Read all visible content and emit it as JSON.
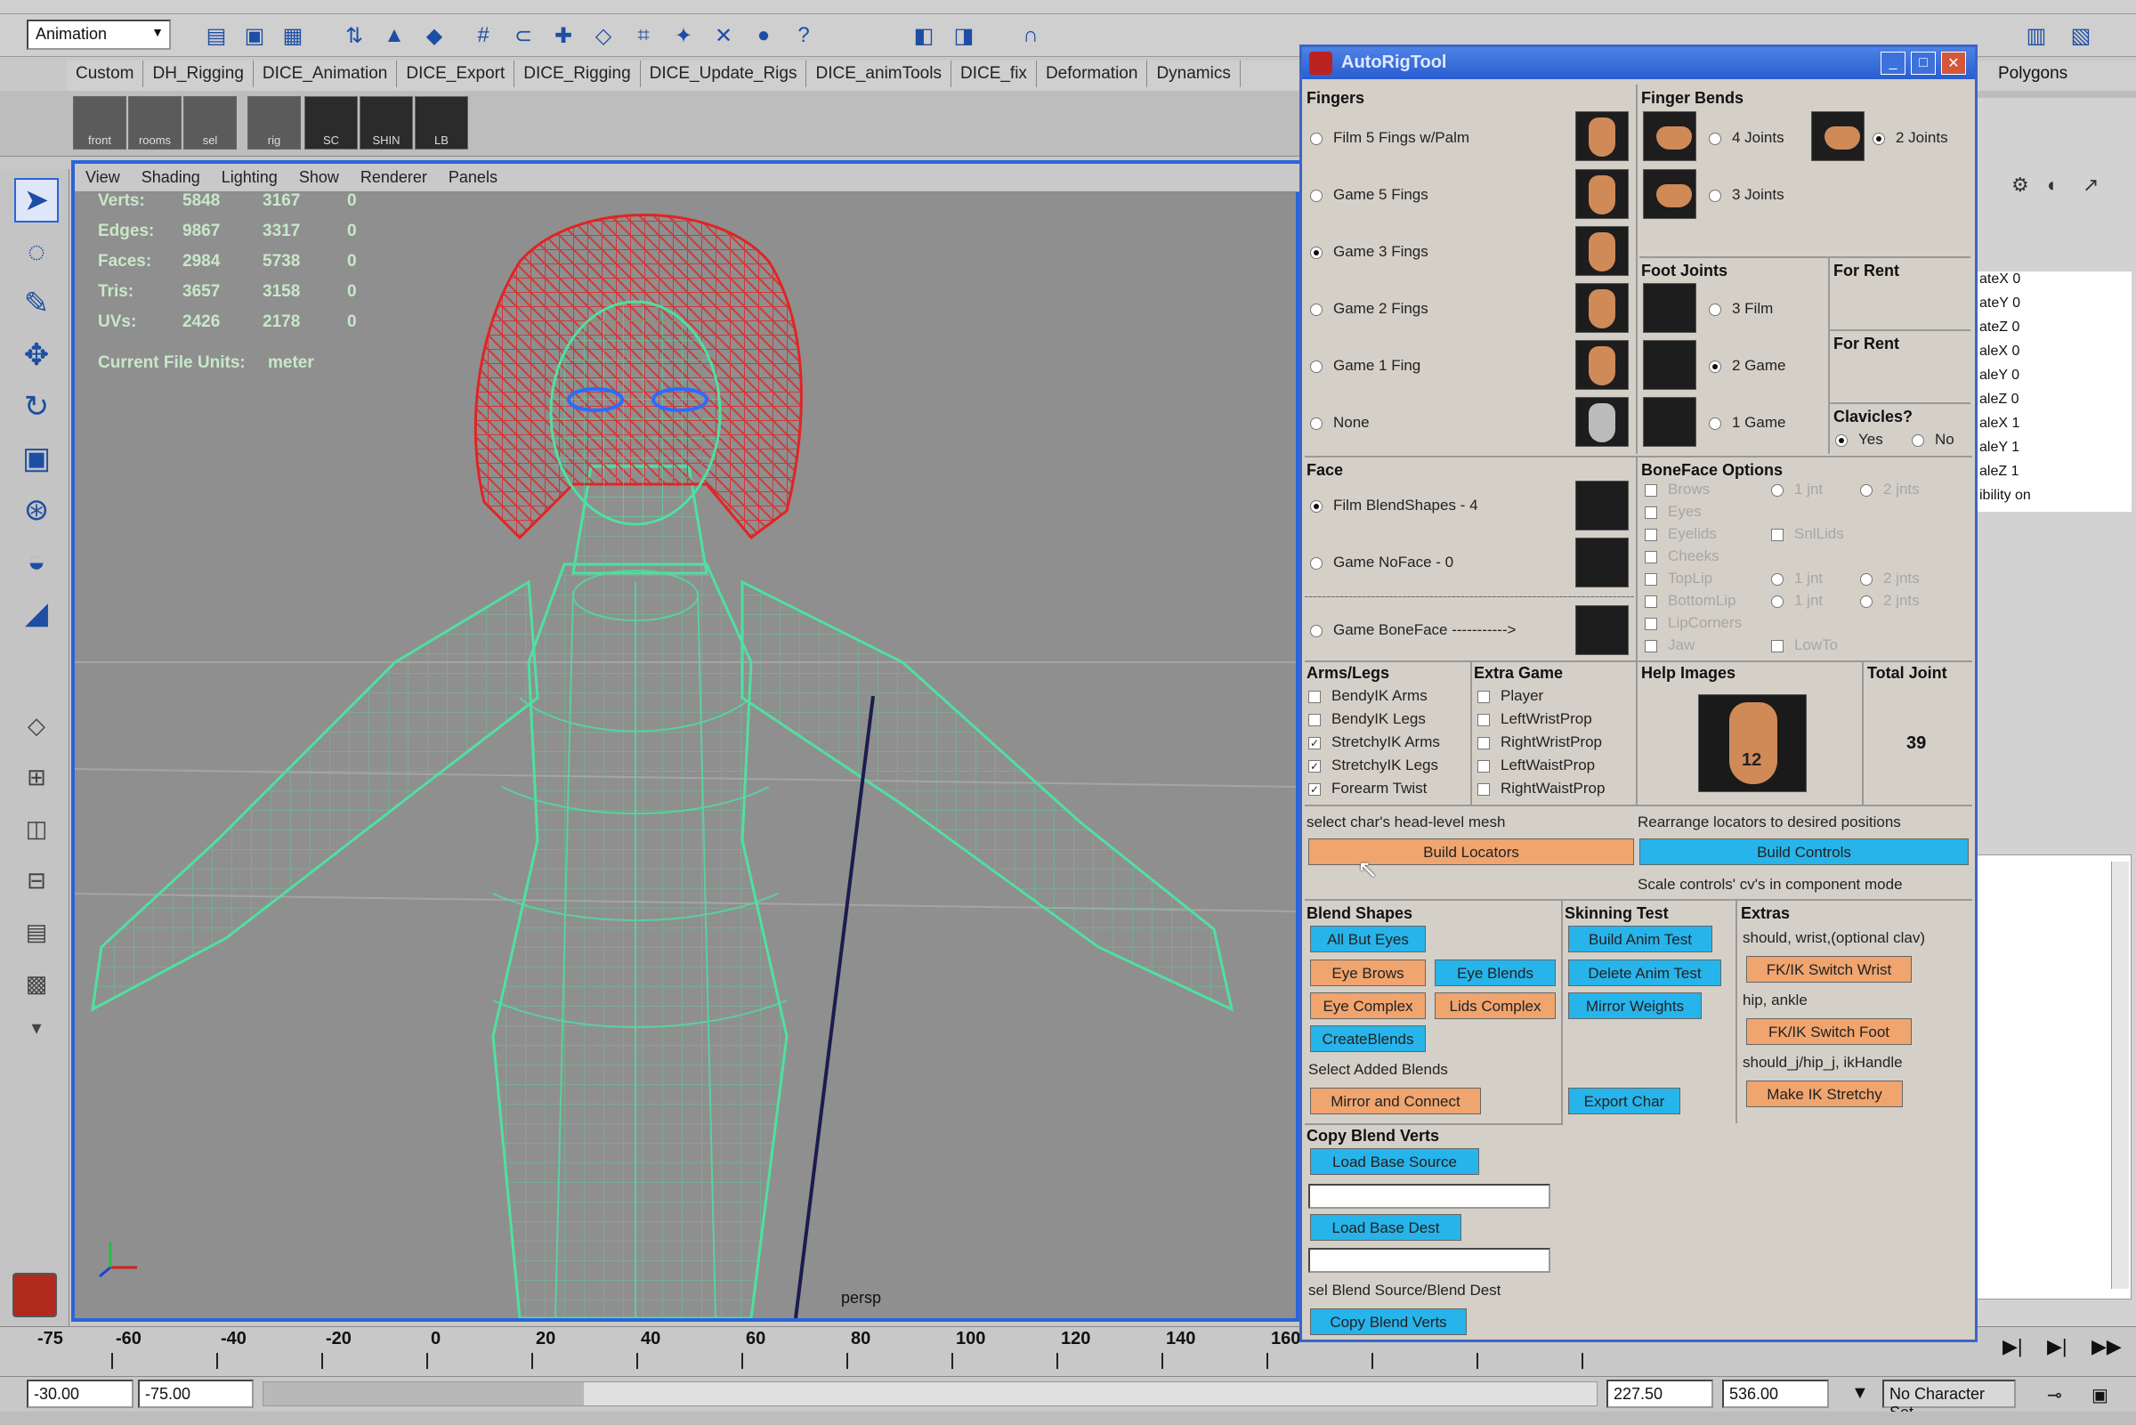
{
  "top": {
    "mode_select": "Animation",
    "shelf_tabs": [
      "Custom",
      "DH_Rigging",
      "DICE_Animation",
      "DICE_Export",
      "DICE_Rigging",
      "DICE_Update_Rigs",
      "DICE_animTools",
      "DICE_fix",
      "Deformation",
      "Dynamics",
      "Polygons"
    ],
    "shelf_icons": [
      "front",
      "rooms",
      "sel",
      "rig",
      "SC",
      "SHIN",
      "LB"
    ]
  },
  "viewport": {
    "menu": [
      "View",
      "Shading",
      "Lighting",
      "Show",
      "Renderer",
      "Panels"
    ],
    "hud": [
      {
        "label": "Verts:",
        "a": "5848",
        "b": "3167",
        "c": "0"
      },
      {
        "label": "Edges:",
        "a": "9867",
        "b": "3317",
        "c": "0"
      },
      {
        "label": "Faces:",
        "a": "2984",
        "b": "5738",
        "c": "0"
      },
      {
        "label": "Tris:",
        "a": "3657",
        "b": "3158",
        "c": "0"
      },
      {
        "label": "UVs:",
        "a": "2426",
        "b": "2178",
        "c": "0"
      }
    ],
    "file_units_label": "Current File Units:",
    "file_units_value": "meter",
    "camera": "persp"
  },
  "timeline": {
    "start_tick": "-75",
    "ticks": [
      "-60",
      "-40",
      "-20",
      "0",
      "20",
      "40",
      "60",
      "80",
      "100",
      "120",
      "140",
      "160"
    ],
    "range_start": "-30.00",
    "range_start2": "-75.00",
    "range_end": "227.50",
    "range_end2": "536.00",
    "character_set": "No Character Set"
  },
  "channels": {
    "rows": [
      "ateX 0",
      "ateY 0",
      "ateZ 0",
      "aleX 0",
      "aleY 0",
      "aleZ 0",
      "aleX 1",
      "aleY 1",
      "aleZ 1",
      "ibility on"
    ]
  },
  "dialog": {
    "title": "AutoRigTool",
    "fingers": {
      "header": "Fingers",
      "options": [
        "Film 5 Fings w/Palm",
        "Game 5 Fings",
        "Game 3 Fings",
        "Game 2 Fings",
        "Game 1 Fing",
        "None"
      ],
      "selected": 2
    },
    "finger_bends": {
      "header": "Finger Bends",
      "options": [
        "4 Joints",
        "2 Joints",
        "3 Joints"
      ]
    },
    "foot_joints": {
      "header": "Foot Joints",
      "options": [
        "3 Film",
        "2 Game",
        "1 Game"
      ]
    },
    "for_rent_1": "For Rent",
    "for_rent_2": "For Rent",
    "clavicles": {
      "header": "Clavicles?",
      "yes": "Yes",
      "no": "No"
    },
    "face": {
      "header": "Face",
      "options": [
        "Film BlendShapes - 4",
        "Game NoFace - 0",
        "Game BoneFace ----------->"
      ]
    },
    "boneface": {
      "header": "BoneFace Options",
      "options": [
        "Brows",
        "Eyes",
        "Eyelids",
        "Cheeks",
        "TopLip",
        "BottomLip",
        "LipCorners",
        "Jaw"
      ],
      "right": [
        "1 jnt",
        "2 jnts",
        "SnlLids",
        "1 jnt",
        "2 jnts",
        "1 jnt",
        "2 jnts",
        "LowTo"
      ]
    },
    "arms_legs": {
      "header": "Arms/Legs",
      "options": [
        "BendyIK Arms",
        "BendyIK Legs",
        "StretchyIK Arms",
        "StretchyIK Legs",
        "Forearm Twist"
      ]
    },
    "extra_game": {
      "header": "Extra Game",
      "options": [
        "Player",
        "LeftWristProp",
        "RightWristProp",
        "LeftWaistProp",
        "RightWaistProp"
      ]
    },
    "help_images": {
      "header": "Help Images",
      "badge": "12"
    },
    "total_joints": {
      "header": "Total Joint",
      "value": "39"
    },
    "instructions": {
      "left": "select char's head-level mesh",
      "right": "Rearrange locators to desired positions",
      "scale": "Scale controls' cv's in component mode"
    },
    "build_locators": "Build Locators",
    "build_controls": "Build Controls",
    "blend_shapes": {
      "header": "Blend Shapes",
      "all_but_eyes": "All But Eyes",
      "eye_brows": "Eye Brows",
      "eye_blends": "Eye Blends",
      "eye_complex": "Eye Complex",
      "lids_complex": "Lids Complex",
      "create_blends": "CreateBlends",
      "select_added": "Select Added Blends",
      "mirror_connect": "Mirror and Connect"
    },
    "skinning_test": {
      "header": "Skinning Test",
      "build_anim": "Build Anim Test",
      "delete_anim": "Delete Anim Test",
      "mirror_weights": "Mirror Weights",
      "export_char": "Export Char"
    },
    "extras": {
      "header": "Extras",
      "note1": "should, wrist,(optional clav)",
      "fkik_wrist": "FK/IK Switch Wrist",
      "note2": "hip, ankle",
      "fkik_foot": "FK/IK Switch Foot",
      "note3": "should_j/hip_j, ikHandle",
      "make_ik": "Make IK Stretchy"
    },
    "copy_blend": {
      "header": "Copy Blend Verts",
      "load_source": "Load Base Source",
      "load_dest": "Load Base Dest",
      "note": "sel Blend Source/Blend Dest",
      "copy": "Copy Blend Verts"
    }
  },
  "colors": {
    "mesh_body": "#4fe0a0",
    "mesh_head": "#e02424",
    "btn_blue": "#27b4ea",
    "btn_orange": "#f0a46e",
    "titlebar": "#2a5ed0"
  }
}
